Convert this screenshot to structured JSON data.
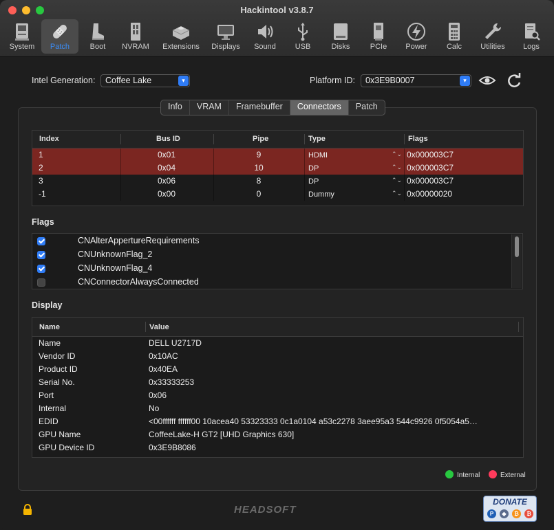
{
  "window": {
    "title": "Hackintool v3.8.7"
  },
  "toolbar": [
    {
      "label": "System",
      "icon": "computer-icon"
    },
    {
      "label": "Patch",
      "icon": "bandage-icon",
      "active": true
    },
    {
      "label": "Boot",
      "icon": "boot-icon"
    },
    {
      "label": "NVRAM",
      "icon": "memory-icon"
    },
    {
      "label": "Extensions",
      "icon": "lego-brick-icon"
    },
    {
      "label": "Displays",
      "icon": "monitor-icon"
    },
    {
      "label": "Sound",
      "icon": "speaker-icon"
    },
    {
      "label": "USB",
      "icon": "usb-icon"
    },
    {
      "label": "Disks",
      "icon": "disk-icon"
    },
    {
      "label": "PCIe",
      "icon": "pcie-card-icon"
    },
    {
      "label": "Power",
      "icon": "power-bolt-icon"
    },
    {
      "label": "Calc",
      "icon": "calculator-icon"
    },
    {
      "label": "Utilities",
      "icon": "wrench-icon"
    },
    {
      "label": "Logs",
      "icon": "log-search-icon"
    }
  ],
  "intel_generation": {
    "label": "Intel Generation:",
    "value": "Coffee Lake"
  },
  "platform_id": {
    "label": "Platform ID:",
    "value": "0x3E9B0007"
  },
  "tabs": [
    "Info",
    "VRAM",
    "Framebuffer",
    "Connectors",
    "Patch"
  ],
  "active_tab": "Connectors",
  "connectors": {
    "headers": [
      "Index",
      "Bus ID",
      "Pipe",
      "Type",
      "Flags"
    ],
    "rows": [
      {
        "index": "1",
        "bus_id": "0x01",
        "pipe": "9",
        "type": "HDMI",
        "flags": "0x000003C7",
        "selected": true
      },
      {
        "index": "2",
        "bus_id": "0x04",
        "pipe": "10",
        "type": "DP",
        "flags": "0x000003C7",
        "selected": true
      },
      {
        "index": "3",
        "bus_id": "0x06",
        "pipe": "8",
        "type": "DP",
        "flags": "0x000003C7",
        "selected": false
      },
      {
        "index": "-1",
        "bus_id": "0x00",
        "pipe": "0",
        "type": "Dummy",
        "flags": "0x00000020",
        "selected": false
      }
    ]
  },
  "flags_section": {
    "title": "Flags",
    "items": [
      {
        "label": "CNAlterAppertureRequirements",
        "checked": true
      },
      {
        "label": "CNUnknownFlag_2",
        "checked": true
      },
      {
        "label": "CNUnknownFlag_4",
        "checked": true
      },
      {
        "label": "CNConnectorAlwaysConnected",
        "checked": false
      }
    ]
  },
  "display_section": {
    "title": "Display",
    "headers": [
      "Name",
      "Value"
    ],
    "rows": [
      {
        "name": "Name",
        "value": "DELL U2717D"
      },
      {
        "name": "Vendor ID",
        "value": "0x10AC"
      },
      {
        "name": "Product ID",
        "value": "0x40EA"
      },
      {
        "name": "Serial No.",
        "value": "0x33333253"
      },
      {
        "name": "Port",
        "value": "0x06"
      },
      {
        "name": "Internal",
        "value": "No"
      },
      {
        "name": "EDID",
        "value": "<00ffffff ffffff00 10acea40 53323333 0c1a0104 a53c2278 3aee95a3 544c9926 0f5054a5…"
      },
      {
        "name": "GPU Name",
        "value": "CoffeeLake-H GT2 [UHD Graphics 630]"
      },
      {
        "name": "GPU Device ID",
        "value": "0x3E9B8086"
      }
    ]
  },
  "legend": {
    "internal": "Internal",
    "external": "External",
    "internal_color": "#28c840",
    "external_color": "#ff3b5c"
  },
  "footer": {
    "brand": "HEADSOFT",
    "donate": "DONATE"
  },
  "colors": {
    "accent": "#2f7cf6",
    "selected_row": "#7b2621"
  }
}
